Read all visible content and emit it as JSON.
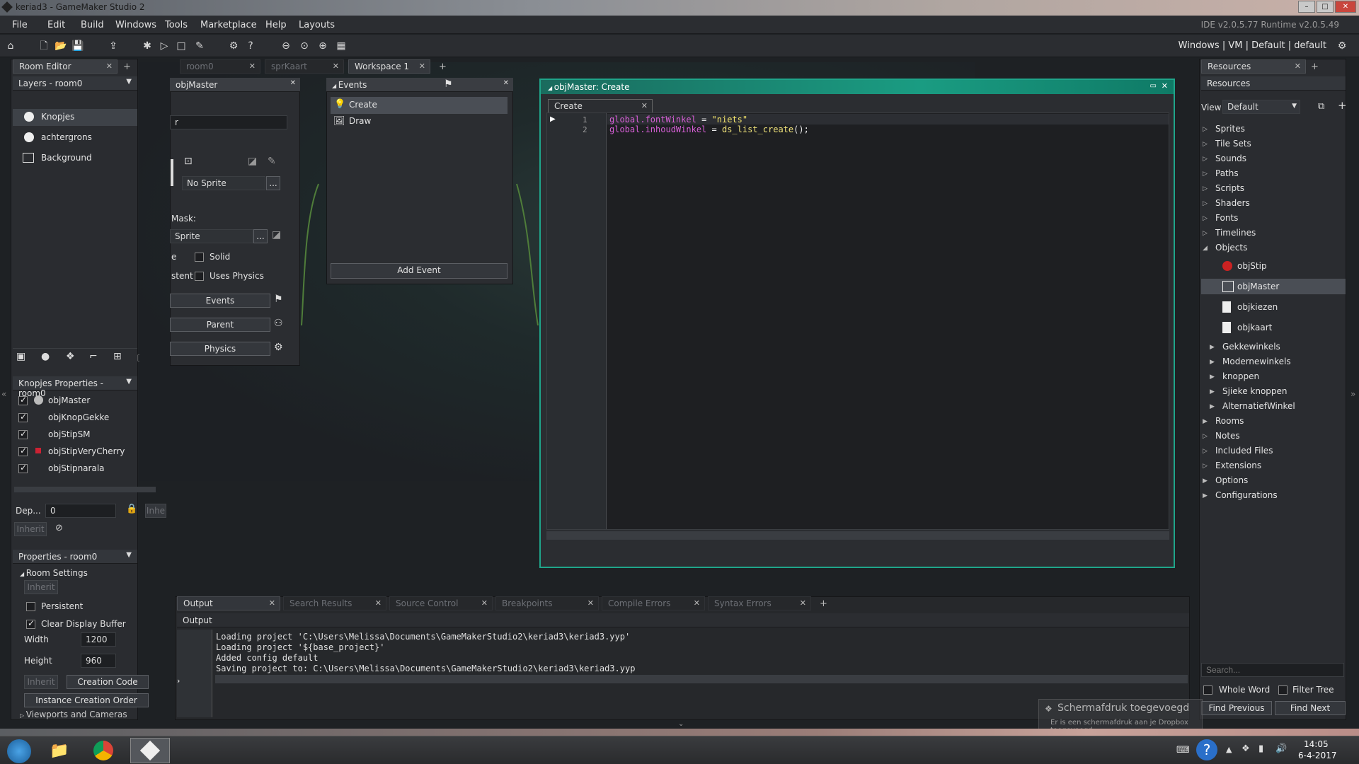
{
  "window": {
    "title": "keriad3 - GameMaker Studio 2",
    "ide_version": "IDE v2.0.5.77  Runtime v2.0.5.49"
  },
  "menu": [
    "File",
    "Edit",
    "Build",
    "Windows",
    "Tools",
    "Marketplace",
    "Help",
    "Layouts"
  ],
  "toolbar": {
    "targets": "Windows  |  VM  |  Default  |  default"
  },
  "room_editor": {
    "tab": "Room Editor",
    "layers_header": "Layers - room0",
    "layers": [
      "Knopjes",
      "achtergrons",
      "Background"
    ],
    "props_header": "Knopjes Properties - room0",
    "instances": [
      "objMaster",
      "objKnopGekke",
      "objStipSM",
      "objStipVeryCherry",
      "objStipnarala"
    ],
    "depth_label": "Dep...",
    "depth_value": "0",
    "inherit": "Inherit",
    "inherit_short": "Inhe",
    "room_props_header": "Properties - room0",
    "room_settings": "Room Settings",
    "persistent": "Persistent",
    "clear_display": "Clear Display Buffer",
    "width_label": "Width",
    "width_value": "1200",
    "height_label": "Height",
    "height_value": "960",
    "creation_code": "Creation Code",
    "instance_order": "Instance Creation Order",
    "viewports": "Viewports and Cameras"
  },
  "tabs": {
    "room0": "room0",
    "sprKaart": "sprKaart",
    "workspace": "Workspace 1"
  },
  "object_window": {
    "title": "objMaster",
    "name_fragment": "r",
    "no_sprite": "No Sprite",
    "mask_label": "Mask:",
    "mask_value": "Sprite",
    "dots": "...",
    "solid_prefix": "e",
    "solid": "Solid",
    "persistent_prefix": "stent",
    "uses_physics": "Uses Physics",
    "events_btn": "Events",
    "parent_btn": "Parent",
    "physics_btn": "Physics"
  },
  "events_window": {
    "title": "Events",
    "events": [
      "Create",
      "Draw"
    ],
    "add_event": "Add Event"
  },
  "code_editor": {
    "title": "objMaster: Create",
    "tab": "Create",
    "lines": [
      {
        "num": "1",
        "a": "global",
        "b": ".fontWinkel",
        "c": " = ",
        "d": "\"niets\"",
        "e": ""
      },
      {
        "num": "2",
        "a": "global",
        "b": ".inhoudWinkel",
        "c": " = ",
        "d": "ds_list_create",
        "e": "();"
      }
    ]
  },
  "output": {
    "tabs": [
      "Output",
      "Search Results",
      "Source Control",
      "Breakpoints",
      "Compile Errors",
      "Syntax Errors"
    ],
    "header": "Output",
    "lines": [
      "Loading project 'C:\\Users\\Melissa\\Documents\\GameMakerStudio2\\keriad3\\keriad3.yyp'",
      "Loading project '${base_project}'",
      "Added config default",
      "Saving project to: C:\\Users\\Melissa\\Documents\\GameMakerStudio2\\keriad3\\keriad3.yyp"
    ]
  },
  "resources": {
    "tab": "Resources",
    "header": "Resources",
    "view_label": "View",
    "view_value": "Default",
    "tree": [
      "Sprites",
      "Tile Sets",
      "Sounds",
      "Paths",
      "Scripts",
      "Shaders",
      "Fonts",
      "Timelines",
      "Objects"
    ],
    "objects": [
      "objStip",
      "objMaster",
      "objkiezen",
      "objkaart"
    ],
    "groups": [
      "Gekkewinkels",
      "Modernewinkels",
      "knoppen",
      "Sjieke knoppen",
      "AlternatiefWinkel"
    ],
    "tree_after": [
      "Rooms",
      "Notes",
      "Included Files",
      "Extensions",
      "Options",
      "Configurations"
    ],
    "search_placeholder": "Search...",
    "whole_word": "Whole Word",
    "filter_tree": "Filter Tree",
    "find_prev": "Find Previous",
    "find_next": "Find Next"
  },
  "notification": {
    "title": "Schermafdruk toegevoegd",
    "body": "Er is een schermafdruk aan je Dropbox toegevoegd"
  },
  "taskbar": {
    "time": "14:05",
    "date": "6-4-2017"
  },
  "colors": {
    "accent": "#1fa58a",
    "keyword": "#d75fd7",
    "string": "#f5e66b",
    "function": "#f0e37a"
  }
}
